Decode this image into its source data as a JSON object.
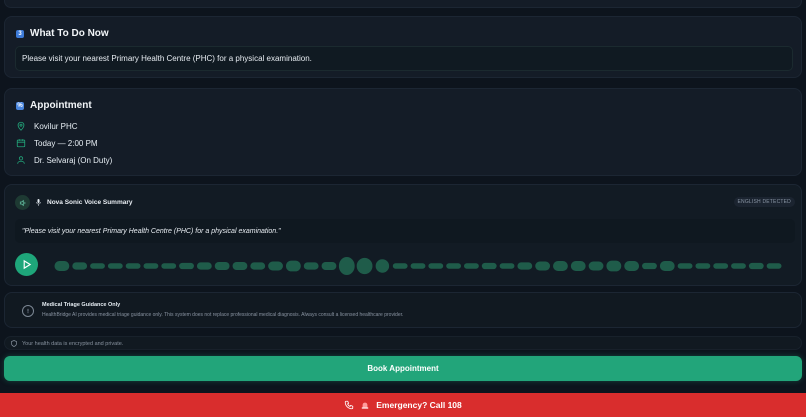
{
  "todo": {
    "badge": "3",
    "title": "What To Do Now",
    "instruction": "Please visit your nearest Primary Health Centre (PHC) for a physical examination."
  },
  "appointment": {
    "title": "Appointment",
    "location": "Kovilur PHC",
    "time": "Today — 2:00 PM",
    "doctor": "Dr. Selvaraj (On Duty)"
  },
  "voice": {
    "title": "Nova Sonic Voice Summary",
    "language_badge": "ENGLISH DETECTED",
    "quote": "\"Please visit your nearest Primary Health Centre (PHC) for a physical examination.\"",
    "waveform_levels": [
      0.55,
      0.4,
      0.3,
      0.3,
      0.3,
      0.3,
      0.3,
      0.35,
      0.4,
      0.45,
      0.45,
      0.4,
      0.5,
      0.6,
      0.4,
      0.45,
      1.0,
      0.9,
      0.75,
      0.3,
      0.3,
      0.3,
      0.3,
      0.3,
      0.35,
      0.3,
      0.4,
      0.5,
      0.55,
      0.55,
      0.5,
      0.6,
      0.55,
      0.35,
      0.55,
      0.3,
      0.3,
      0.3,
      0.3,
      0.35,
      0.3
    ]
  },
  "disclaimer": {
    "title": "Medical Triage Guidance Only",
    "text": "HealthBridge AI provides medical triage guidance only. This system does not replace professional medical diagnosis. Always consult a licensed healthcare provider."
  },
  "privacy": {
    "text": "Your health data is encrypted and private."
  },
  "actions": {
    "book_label": "Book Appointment",
    "emergency_label": "Emergency? Call 108"
  },
  "colors": {
    "accent": "#22a57a",
    "emergency": "#d92d2d",
    "background": "#0d141d"
  }
}
